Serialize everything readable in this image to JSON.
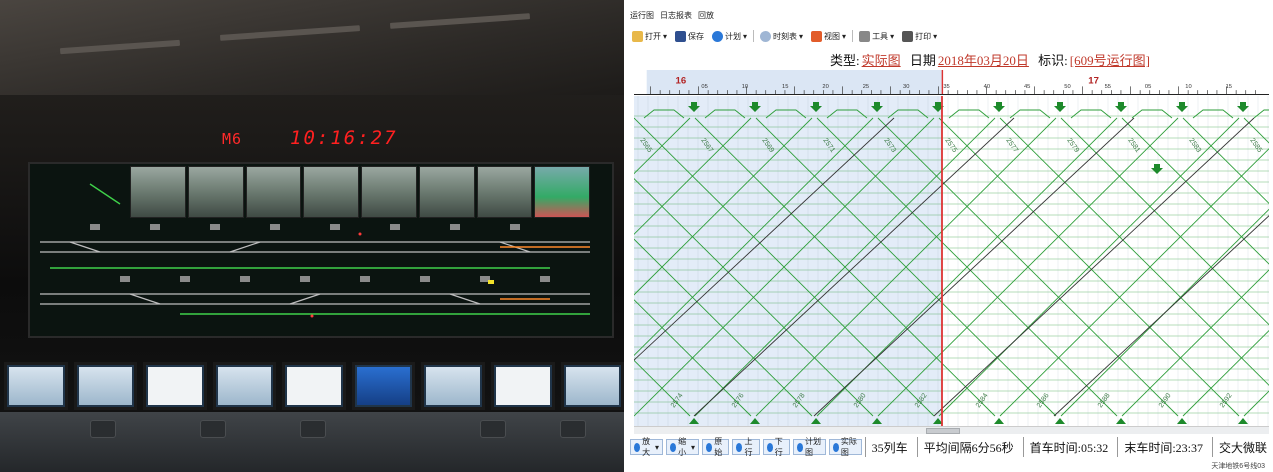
{
  "photo": {
    "station_code": "M6",
    "clock": "10:16:27"
  },
  "app": {
    "menu": [
      "运行图",
      "日志报表",
      "回放"
    ],
    "toolbar": [
      {
        "label": "打开",
        "icon": "folder-icon"
      },
      {
        "label": "保存",
        "icon": "save-icon"
      },
      {
        "label": "计划",
        "icon": "plan-icon"
      },
      {
        "label": "时刻表",
        "icon": "clock-icon"
      },
      {
        "label": "视图",
        "icon": "view-icon"
      },
      {
        "label": "工具",
        "icon": "tools-icon"
      },
      {
        "label": "打印",
        "icon": "print-icon"
      }
    ],
    "info": {
      "type_label": "类型:",
      "type_value": "实际图",
      "date_label": "日期",
      "date_value": "2018年03月20日",
      "id_label": "标识:",
      "id_value": "[609号运行图]"
    },
    "ruler": {
      "hours": [
        "16",
        "17"
      ],
      "minutes": [
        "05",
        "10",
        "15",
        "20",
        "25",
        "30",
        "35",
        "40",
        "45",
        "50",
        "55",
        "05",
        "10",
        "15",
        "20"
      ]
    },
    "chart_labels": {
      "trains_top": [
        "2565",
        "2567",
        "2569",
        "2571",
        "2573",
        "2575",
        "2577",
        "2579",
        "2581",
        "2583",
        "2585"
      ],
      "trains_bottom": [
        "2574",
        "2576",
        "2578",
        "2580",
        "2582",
        "2584",
        "2586",
        "2588",
        "2590",
        "2592",
        "2594"
      ]
    },
    "bottom_buttons": [
      "放大",
      "缩小",
      "原始",
      "上行",
      "下行",
      "计划图",
      "实际图"
    ],
    "stats": {
      "train_count": "35列车",
      "avg_interval": "平均间隔6分56秒",
      "first_train": "首车时间:05:32",
      "last_train": "末车时间:23:37",
      "org": "交大微联"
    },
    "footer": "天津地铁6号线03"
  },
  "colors": {
    "accent_red": "#c0392b",
    "grid_green": "#2e9e3a",
    "arrow_green": "#1d8a2b"
  }
}
